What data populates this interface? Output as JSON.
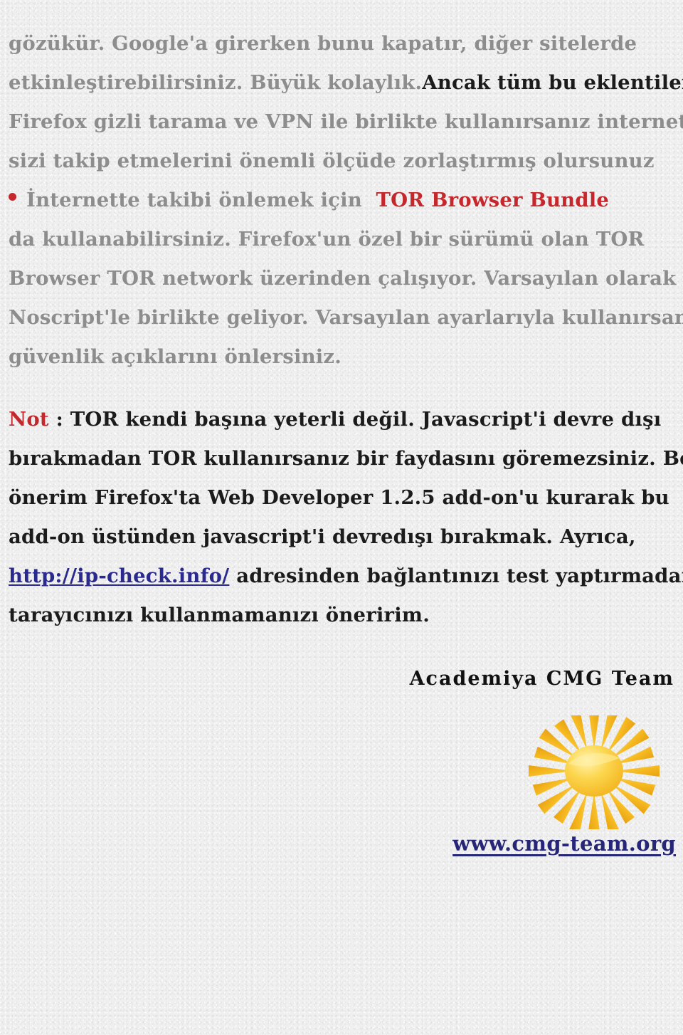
{
  "page": {
    "background_color": "#efefef",
    "body_text_color": "#8d8d8d",
    "accent_red": "#c5282c",
    "dark_text_color": "#1b1b1b",
    "link_color": "#2a2a8e",
    "footer_link_color": "#262678"
  },
  "body": {
    "line1": "gözükür. Google'a girerken bunu kapatır, diğer sitelerde",
    "line2_a": "etkinleştirebilirsiniz. Büyük kolaylık.",
    "line2_b": "Ancak tüm bu eklentileri",
    "line3": "Firefox gizli tarama ve VPN ile birlikte kullanırsanız internette",
    "line4": "sizi takip etmelerini önemli ölçüde zorlaştırmış olursunuz",
    "bullet_line_a": "İnternette takibi önlemek için",
    "bullet_line_b": "TOR Browser Bundle",
    "line6": "da kullanabilirsiniz. Firefox'un özel bir sürümü olan TOR",
    "line7": "Browser TOR network üzerinden çalışıyor. Varsayılan olarak",
    "line8": "Noscript'le birlikte geliyor. Varsayılan ayarlarıyla kullanırsanız",
    "line9": "güvenlik açıklarını önlersiniz."
  },
  "note": {
    "label": "Not",
    "colon": ":",
    "line1_rest": "TOR kendi başına yeterli değil. Javascript'i devre dışı",
    "line2": "bırakmadan TOR kullanırsanız bir faydasını göremezsiniz. Benim",
    "line3": "önerim Firefox'ta Web Developer 1.2.5 add-on'u kurarak bu",
    "line4": "add-on üstünden javascript'i devredışı bırakmak. Ayrıca,",
    "line5_link": "http://ip-check.info/",
    "line5_rest": "adresinden bağlantınızı test yaptırmadan",
    "line6": "tarayıcınızı kullanmamanızı öneririm."
  },
  "footer": {
    "signature": "Academiya CMG Team",
    "logo_name": "sun-logo",
    "site_url": "www.cmg-team.org"
  }
}
